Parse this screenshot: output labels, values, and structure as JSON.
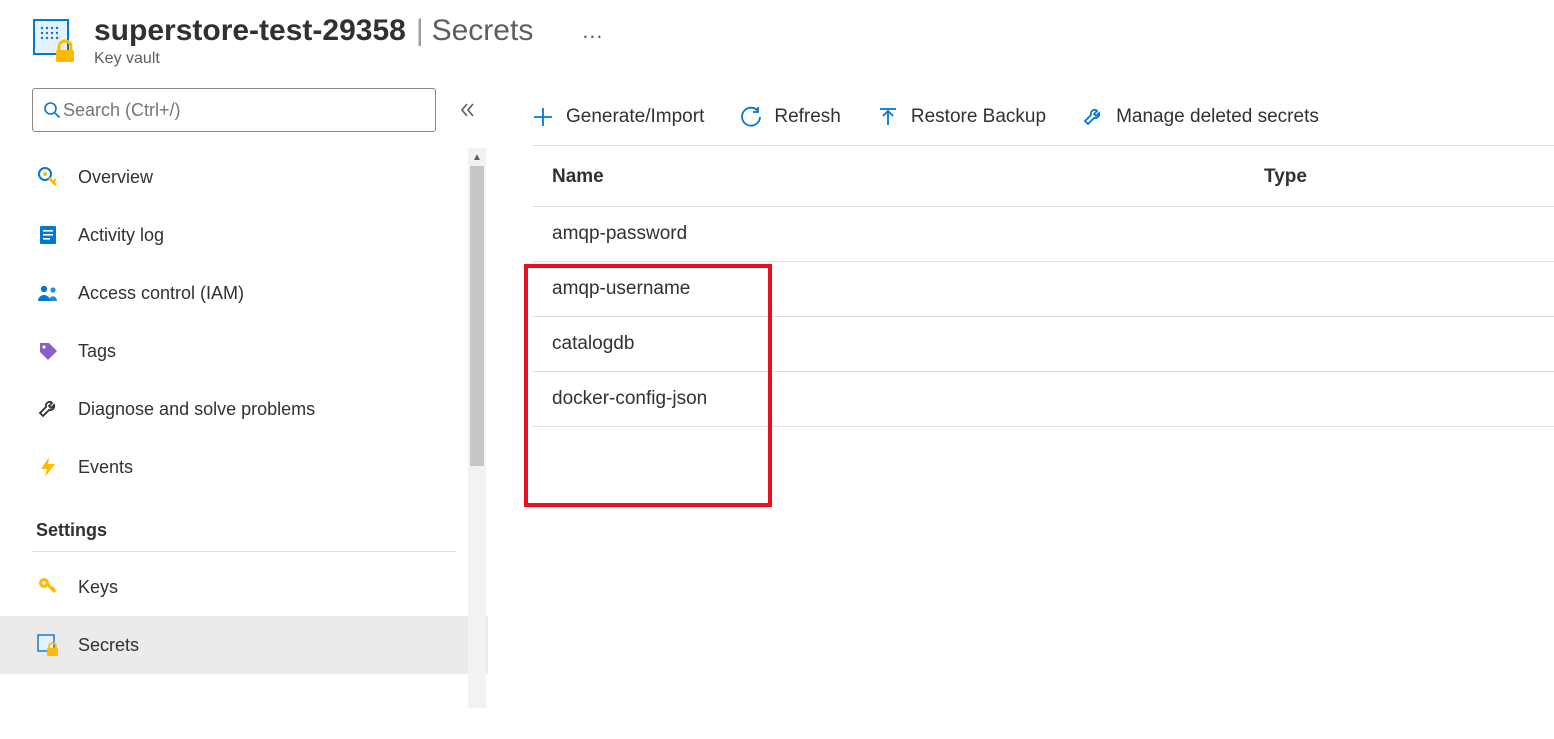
{
  "header": {
    "title": "superstore-test-29358",
    "section": "Secrets",
    "resource_type": "Key vault",
    "more_label": "…"
  },
  "sidebar": {
    "search_placeholder": "Search (Ctrl+/)",
    "items": [
      {
        "id": "overview",
        "label": "Overview"
      },
      {
        "id": "activity-log",
        "label": "Activity log"
      },
      {
        "id": "access-control",
        "label": "Access control (IAM)"
      },
      {
        "id": "tags",
        "label": "Tags"
      },
      {
        "id": "diagnose",
        "label": "Diagnose and solve problems"
      },
      {
        "id": "events",
        "label": "Events"
      }
    ],
    "section_settings": "Settings",
    "settings_items": [
      {
        "id": "keys",
        "label": "Keys"
      },
      {
        "id": "secrets",
        "label": "Secrets",
        "selected": true
      }
    ]
  },
  "toolbar": {
    "generate_import": "Generate/Import",
    "refresh": "Refresh",
    "restore_backup": "Restore Backup",
    "manage_deleted": "Manage deleted secrets"
  },
  "table": {
    "columns": {
      "name": "Name",
      "type": "Type"
    },
    "rows": [
      {
        "name": "amqp-password",
        "type": ""
      },
      {
        "name": "amqp-username",
        "type": ""
      },
      {
        "name": "catalogdb",
        "type": ""
      },
      {
        "name": "docker-config-json",
        "type": ""
      }
    ]
  }
}
